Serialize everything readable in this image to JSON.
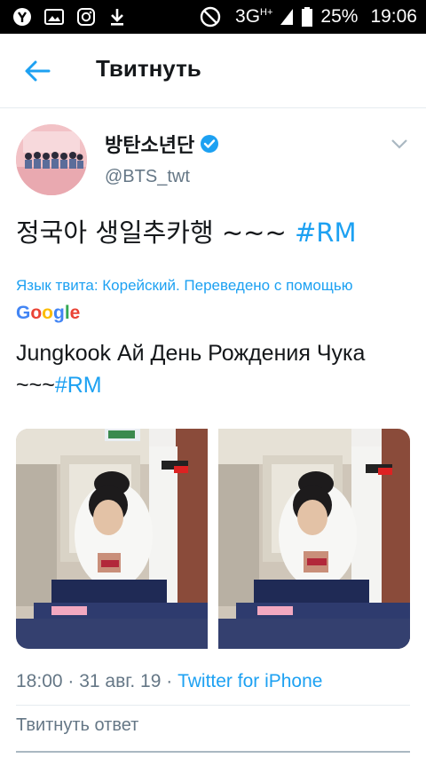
{
  "status_bar": {
    "network": "3G",
    "network_sup": "H+",
    "battery": "25%",
    "time": "19:06"
  },
  "header": {
    "title": "Твитнуть"
  },
  "tweet": {
    "author_name": "방탄소년단",
    "author_handle": "@BTS_twt",
    "text_main": "정국아 생일추카행 ~~~ ",
    "text_hashtag": "#RM",
    "translation_note": "Язык твита: Корейский. Переведено с помощью",
    "translation_provider": "Google",
    "translated_main": "Jungkook Ай День Рождения Чука ~~~",
    "translated_hashtag": "#RM",
    "time": "18:00",
    "date": "31 авг. 19",
    "source": "Twitter for iPhone"
  },
  "reply": {
    "placeholder": "Твитнуть ответ"
  },
  "colors": {
    "accent": "#1da1f2",
    "muted": "#657786"
  },
  "icons": [
    "yandex-icon",
    "image-icon",
    "instagram-icon",
    "download-icon",
    "dnd-icon",
    "signal-icon",
    "battery-icon",
    "back-arrow-icon",
    "verified-icon",
    "chevron-down-icon"
  ]
}
